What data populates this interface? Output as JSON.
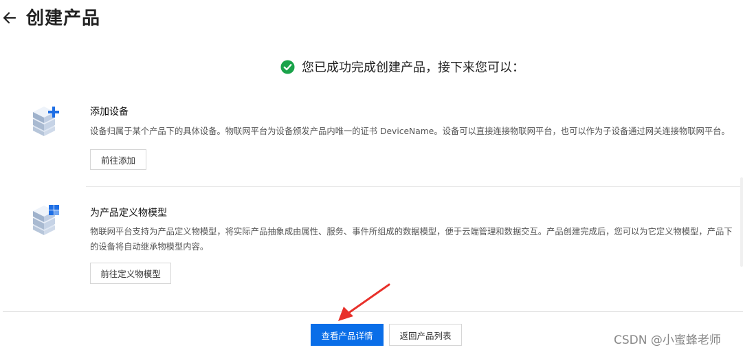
{
  "header": {
    "title": "创建产品"
  },
  "success": {
    "message": "您已成功完成创建产品，接下来您可以："
  },
  "sections": [
    {
      "title": "添加设备",
      "description": "设备归属于某个产品下的具体设备。物联网平台为设备颁发产品内唯一的证书 DeviceName。设备可以直接连接物联网平台，也可以作为子设备通过网关连接物联网平台。",
      "button": "前往添加",
      "icon": "add-device-icon"
    },
    {
      "title": "为产品定义物模型",
      "description": "物联网平台支持为产品定义物模型，将实际产品抽象成由属性、服务、事件所组成的数据模型，便于云端管理和数据交互。产品创建完成后，您可以为它定义物模型，产品下的设备将自动继承物模型内容。",
      "button": "前往定义物模型",
      "icon": "thing-model-icon"
    }
  ],
  "footer": {
    "primary": "查看产品详情",
    "secondary": "返回产品列表"
  },
  "watermark": "CSDN @小蜜蜂老师",
  "colors": {
    "primary": "#0a6ee8",
    "success": "#1aa34a",
    "annotation_arrow": "#e8302a"
  }
}
